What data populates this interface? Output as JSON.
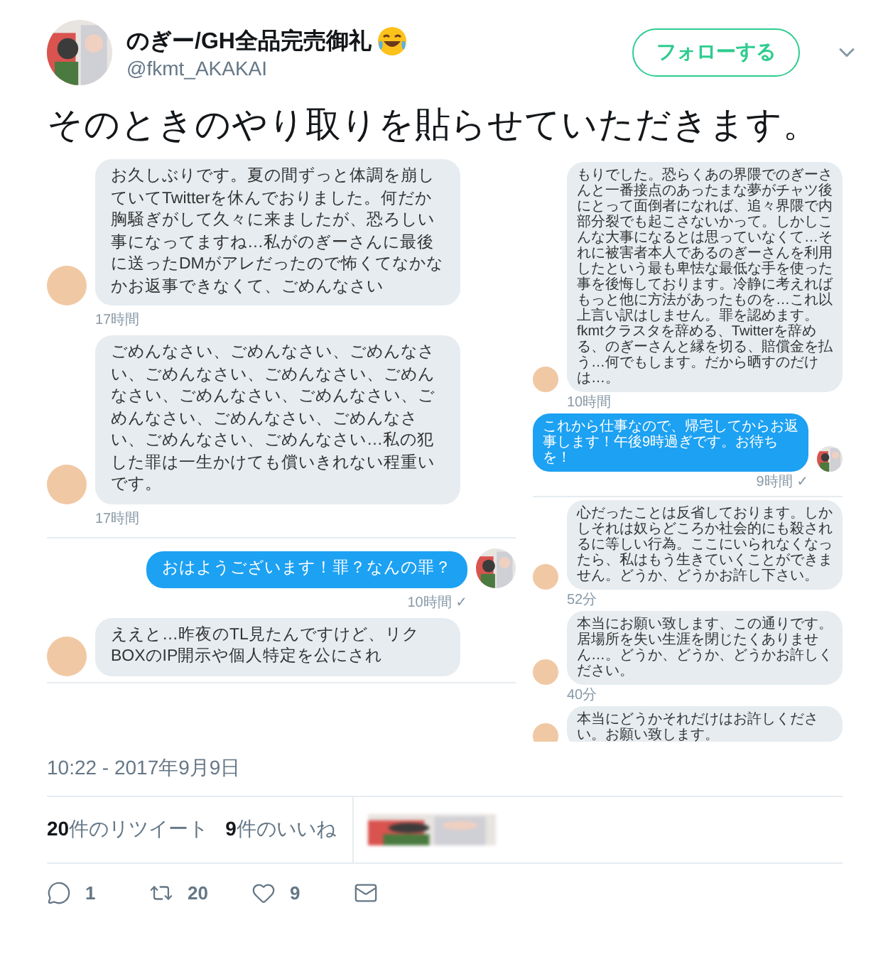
{
  "author": {
    "name": "のぎー/GH全品完売御礼",
    "handle": "@fkmt_AKAKAI"
  },
  "follow_button": "フォローする",
  "text": "そのときのやり取りを貼らせていただきます。",
  "media": [
    {
      "panels": [
        {
          "messages": [
            {
              "kind": "received",
              "text": "お久しぶりです。夏の間ずっと体調を崩していてTwitterを休んでおりました。何だか胸騒ぎがして久々に来ましたが、恐ろしい事になってますね…私がのぎーさんに最後に送ったDMがアレだったので怖くてなかなかお返事できなくて、ごめんなさい",
              "time": "17時間"
            },
            {
              "kind": "received",
              "text": "ごめんなさい、ごめんなさい、ごめんなさい、ごめんなさい、ごめんなさい、ごめんなさい、ごめんなさい、ごめんなさい、ごめんなさい、ごめんなさい、ごめんなさい、ごめんなさい、ごめんなさい…私の犯した罪は一生かけても償いきれない程重いです。",
              "time": "17時間"
            },
            {
              "kind": "divider"
            },
            {
              "kind": "sent",
              "text": "おはようございます！罪？なんの罪？",
              "time": "10時間 ✓"
            },
            {
              "kind": "received",
              "text": "ええと…昨夜のTL見たんですけど、リクBOXのIP開示や個人特定を公にされ"
            }
          ]
        }
      ]
    },
    {
      "panels": [
        {
          "messages": [
            {
              "kind": "received",
              "text": "もりでした。恐らくあの界隈でのぎーさんと一番接点のあったまな夢がチャツ後にとって面倒者になれば、追々界隈で内部分裂でも起こさないかって。しかしこんな大事になるとは思っていなくて…それに被害者本人であるのぎーさんを利用したという最も卑怯な最低な手を使った事を後悔しております。冷静に考えればもっと他に方法があったものを…これ以上言い訳はしません。罪を認めます。fkmtクラスタを辞める、Twitterを辞める、のぎーさんと縁を切る、賠償金を払う…何でもします。だから晒すのだけは…。",
              "time": "10時間"
            },
            {
              "kind": "sent",
              "text": "これから仕事なので、帰宅してからお返事します！午後9時過ぎです。お待ちを！",
              "time": "9時間 ✓"
            }
          ]
        },
        {
          "messages": [
            {
              "kind": "received",
              "text": "心だったことは反省しております。しかしそれは奴らどころか社会的にも殺されるに等しい行為。ここにいられなくなったら、私はもう生きていくことができません。どうか、どうかお許し下さい。",
              "time": "52分"
            },
            {
              "kind": "received",
              "text": "本当にお願い致します、この通りです。居場所を失い生涯を閉じたくありません…。どうか、どうか、どうかお許しください。",
              "time": "40分"
            },
            {
              "kind": "received",
              "text": "本当にどうかそれだけはお許しください。お願い致します。"
            }
          ]
        }
      ]
    }
  ],
  "timestamp": "10:22 - 2017年9月9日",
  "stats": [
    {
      "count": "20",
      "label": "件のリツイート"
    },
    {
      "count": "9",
      "label": "件のいいね"
    }
  ],
  "actions": [
    {
      "kind": "reply",
      "count": "1"
    },
    {
      "kind": "retweet",
      "count": "20"
    },
    {
      "kind": "like",
      "count": "9"
    },
    {
      "kind": "message"
    }
  ]
}
